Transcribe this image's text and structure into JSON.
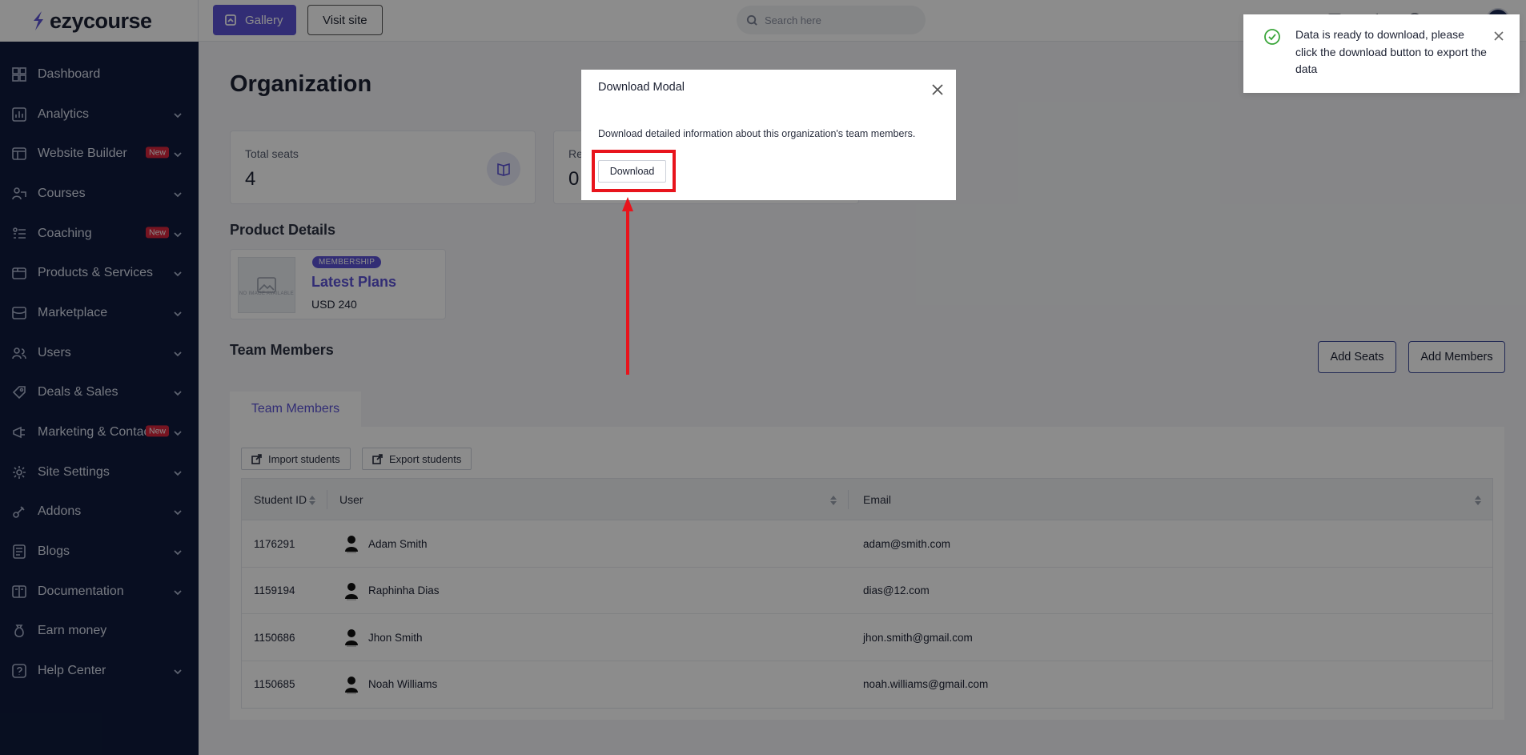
{
  "app": {
    "logo_text": "ezycourse"
  },
  "topbar": {
    "gallery_label": "Gallery",
    "visit_site_label": "Visit site",
    "search_placeholder": "Search here"
  },
  "sidebar": {
    "items": [
      {
        "label": "Dashboard",
        "icon": "dashboard-icon",
        "has_chevron": false,
        "badge": ""
      },
      {
        "label": "Analytics",
        "icon": "analytics-icon",
        "has_chevron": true,
        "badge": ""
      },
      {
        "label": "Website Builder",
        "icon": "website-builder-icon",
        "has_chevron": true,
        "badge": "New"
      },
      {
        "label": "Courses",
        "icon": "courses-icon",
        "has_chevron": true,
        "badge": ""
      },
      {
        "label": "Coaching",
        "icon": "coaching-icon",
        "has_chevron": true,
        "badge": "New"
      },
      {
        "label": "Products & Services",
        "icon": "products-icon",
        "has_chevron": true,
        "badge": ""
      },
      {
        "label": "Marketplace",
        "icon": "marketplace-icon",
        "has_chevron": true,
        "badge": ""
      },
      {
        "label": "Users",
        "icon": "users-icon",
        "has_chevron": true,
        "badge": ""
      },
      {
        "label": "Deals & Sales",
        "icon": "deals-icon",
        "has_chevron": true,
        "badge": ""
      },
      {
        "label": "Marketing & Contacts",
        "icon": "marketing-icon",
        "has_chevron": true,
        "badge": "New"
      },
      {
        "label": "Site Settings",
        "icon": "settings-icon",
        "has_chevron": true,
        "badge": ""
      },
      {
        "label": "Addons",
        "icon": "addons-icon",
        "has_chevron": true,
        "badge": ""
      },
      {
        "label": "Blogs",
        "icon": "blogs-icon",
        "has_chevron": true,
        "badge": ""
      },
      {
        "label": "Documentation",
        "icon": "documentation-icon",
        "has_chevron": true,
        "badge": ""
      },
      {
        "label": "Earn money",
        "icon": "earn-money-icon",
        "has_chevron": false,
        "badge": ""
      },
      {
        "label": "Help Center",
        "icon": "help-icon",
        "has_chevron": true,
        "badge": ""
      }
    ]
  },
  "main": {
    "page_title": "Organization",
    "stats": [
      {
        "label": "Total seats",
        "value": "4"
      },
      {
        "label": "Re",
        "value": "0"
      }
    ],
    "product_section_title": "Product Details",
    "product": {
      "badge": "MEMBERSHIP",
      "name": "Latest Plans",
      "price": "USD 240",
      "thumb_text": "NO IMAGE AVAILABLE"
    },
    "team_section_title": "Team Members",
    "add_seats_label": "Add Seats",
    "add_members_label": "Add Members",
    "tab_label": "Team Members",
    "import_label": "Import students",
    "export_label": "Export students",
    "table": {
      "headers": [
        "Student ID",
        "User",
        "Email"
      ],
      "rows": [
        {
          "id": "1176291",
          "user": "Adam Smith",
          "email": "adam@smith.com"
        },
        {
          "id": "1159194",
          "user": "Raphinha Dias",
          "email": "dias@12.com"
        },
        {
          "id": "1150686",
          "user": "Jhon Smith",
          "email": "jhon.smith@gmail.com"
        },
        {
          "id": "1150685",
          "user": "Noah Williams",
          "email": "noah.williams@gmail.com"
        }
      ]
    }
  },
  "modal": {
    "title": "Download Modal",
    "description": "Download detailed information about this organization's team members.",
    "download_label": "Download"
  },
  "toast": {
    "message": "Data is ready to download, please click the download button to export the data"
  },
  "colors": {
    "sidebar_bg": "#0f1b3d",
    "accent": "#5b53d6",
    "badge_red": "#d7263d",
    "annotation_red": "#e8141c",
    "success_green": "#3aa63a"
  }
}
